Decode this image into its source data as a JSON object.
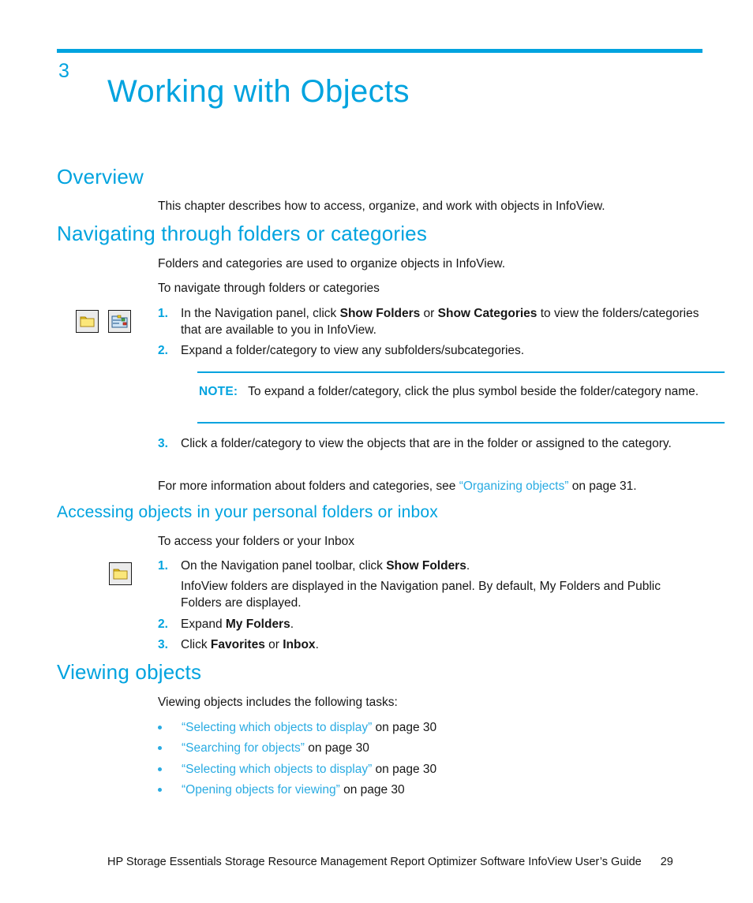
{
  "chapter": {
    "number": "3",
    "title": "Working with Objects"
  },
  "sections": {
    "overview": {
      "heading": "Overview",
      "paragraph": "This chapter describes how to access, organize, and work with objects in InfoView."
    },
    "navigating": {
      "heading": "Navigating through folders or categories",
      "intro": "Folders and categories are used to organize objects in InfoView.",
      "lead_in": "To navigate through folders or categories",
      "steps": [
        {
          "marker": "1.",
          "part1": "In the Navigation panel, click ",
          "bold1": "Show Folders",
          "part2": " or ",
          "bold2": "Show Categories",
          "part3": " to view the folders/categories that are available to you in InfoView."
        },
        {
          "marker": "2.",
          "text": "Expand a folder/category to view any subfolders/subcategories."
        },
        {
          "marker": "3.",
          "text": "Click a folder/category to view the objects that are in the folder or assigned to the category."
        }
      ],
      "note": {
        "label": "NOTE:",
        "text": "To expand a folder/category, click the plus symbol beside the folder/category name."
      },
      "xref": {
        "before": "For more information about folders and categories, see ",
        "open_quote": "“",
        "link": "Organizing objects",
        "close_quote": "”",
        "after": " on page 31."
      },
      "icons": [
        {
          "name": "show-folders-icon",
          "label": "Show Folders"
        },
        {
          "name": "show-categories-icon",
          "label": "Show Categories"
        }
      ]
    },
    "accessing": {
      "heading": "Accessing objects in your personal folders or inbox",
      "lead_in": "To access your folders or your Inbox",
      "icon": {
        "name": "show-folders-icon",
        "label": "Show Folders"
      },
      "steps": [
        {
          "marker": "1.",
          "part1": "On the Navigation panel toolbar, click ",
          "bold1": "Show Folders",
          "part2": ".",
          "continuation": "InfoView folders are displayed in the Navigation panel. By default, My Folders and Public Folders are displayed."
        },
        {
          "marker": "2.",
          "part1": "Expand ",
          "bold1": "My Folders",
          "part2": "."
        },
        {
          "marker": "3.",
          "part1": "Click ",
          "bold1": "Favorites",
          "part2": " or ",
          "bold2": "Inbox",
          "part3": "."
        }
      ]
    },
    "viewing": {
      "heading": "Viewing objects",
      "intro": "Viewing objects includes the following tasks:",
      "bullets": [
        {
          "open_quote": "“",
          "link": "Selecting which objects to display",
          "close_quote": "”",
          "after": " on page 30"
        },
        {
          "open_quote": "“",
          "link": "Searching for objects",
          "close_quote": "”",
          "after": " on page 30"
        },
        {
          "open_quote": "“",
          "link": "Selecting which objects to display",
          "close_quote": "”",
          "after": " on page 30"
        },
        {
          "open_quote": "“",
          "link": "Opening objects for viewing",
          "close_quote": "”",
          "after": " on page 30"
        }
      ]
    }
  },
  "footer": {
    "text": "HP Storage Essentials Storage Resource Management Report Optimizer Software InfoView User’s Guide",
    "page_number": "29"
  },
  "colors": {
    "accent": "#00a3df",
    "link": "#29abe2",
    "text": "#161616"
  }
}
